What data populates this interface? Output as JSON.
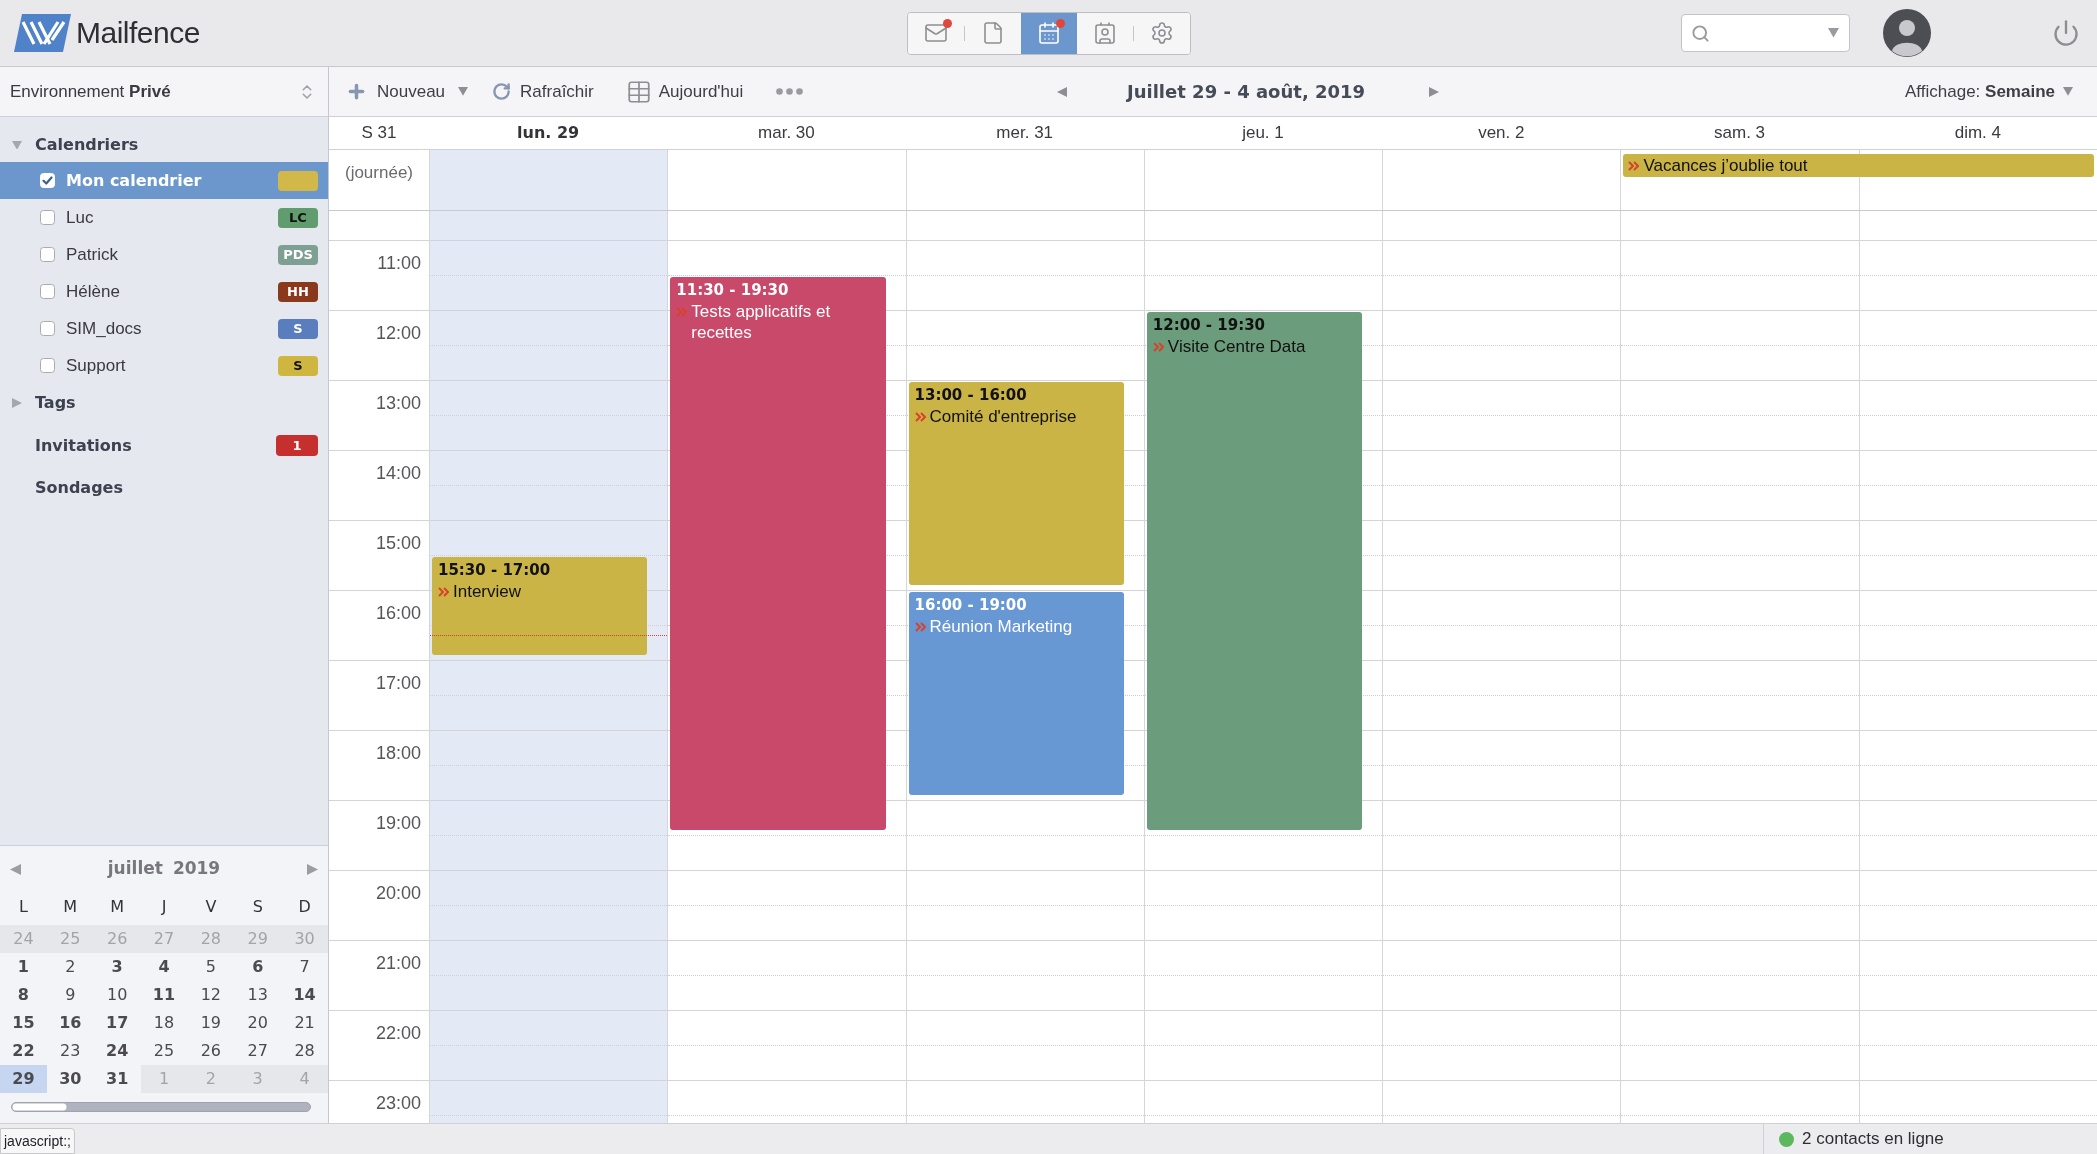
{
  "app": {
    "name": "Mailfence"
  },
  "app_switcher": [
    {
      "kind": "mail",
      "selected": false,
      "notification": true
    },
    {
      "kind": "documents",
      "selected": false,
      "notification": false
    },
    {
      "kind": "calendar",
      "selected": true,
      "notification": true
    },
    {
      "kind": "contacts",
      "selected": false,
      "notification": false
    },
    {
      "kind": "settings",
      "selected": false,
      "notification": false
    }
  ],
  "sidebar": {
    "environment": "Environnement **Privé**",
    "calendars": {
      "title": "Calendriers",
      "expanded": true,
      "items": [
        {
          "name": "Mon calendrier",
          "checked": true,
          "selected": true,
          "color": "#d2b848"
        },
        {
          "name": "Luc",
          "checked": false,
          "selected": false,
          "badge": "LC",
          "color": "#619c6e",
          "dark_text": true
        },
        {
          "name": "Patrick",
          "checked": false,
          "selected": false,
          "badge": "PDS",
          "color": "#7f9f92",
          "dark_text": false
        },
        {
          "name": "Hélène",
          "checked": false,
          "selected": false,
          "badge": "HH",
          "color": "#8a391d",
          "dark_text": false
        },
        {
          "name": "SIM_docs",
          "checked": false,
          "selected": false,
          "badge": "S",
          "color": "#5a7dbd",
          "dark_text": false
        },
        {
          "name": "Support",
          "checked": false,
          "selected": false,
          "badge": "S",
          "color": "#cfb641",
          "dark_text": true
        }
      ]
    },
    "tags": {
      "title": "Tags",
      "expanded": false
    },
    "invitations": {
      "title": "Invitations",
      "count": "1"
    },
    "polls": {
      "title": "Sondages"
    },
    "mini_calendar": {
      "month": "juillet",
      "year": "2019",
      "weekdays": [
        "L",
        "M",
        "M",
        "J",
        "V",
        "S",
        "D"
      ],
      "weeks": [
        {
          "days": [
            {
              "label": "24",
              "other_month": true,
              "has_events": false,
              "selected": false
            },
            {
              "label": "25",
              "other_month": true,
              "has_events": false,
              "selected": false
            },
            {
              "label": "26",
              "other_month": true,
              "has_events": false,
              "selected": false
            },
            {
              "label": "27",
              "other_month": true,
              "has_events": false,
              "selected": false
            },
            {
              "label": "28",
              "other_month": true,
              "has_events": false,
              "selected": false
            },
            {
              "label": "29",
              "other_month": true,
              "has_events": false,
              "selected": false
            },
            {
              "label": "30",
              "other_month": true,
              "has_events": false,
              "selected": false
            }
          ]
        },
        {
          "days": [
            {
              "label": "1",
              "other_month": false,
              "has_events": true,
              "selected": false
            },
            {
              "label": "2",
              "other_month": false,
              "has_events": false,
              "selected": false
            },
            {
              "label": "3",
              "other_month": false,
              "has_events": true,
              "selected": false
            },
            {
              "label": "4",
              "other_month": false,
              "has_events": true,
              "selected": false
            },
            {
              "label": "5",
              "other_month": false,
              "has_events": false,
              "selected": false
            },
            {
              "label": "6",
              "other_month": false,
              "has_events": true,
              "selected": false
            },
            {
              "label": "7",
              "other_month": false,
              "has_events": false,
              "selected": false
            }
          ]
        },
        {
          "days": [
            {
              "label": "8",
              "other_month": false,
              "has_events": true,
              "selected": false
            },
            {
              "label": "9",
              "other_month": false,
              "has_events": false,
              "selected": false
            },
            {
              "label": "10",
              "other_month": false,
              "has_events": false,
              "selected": false
            },
            {
              "label": "11",
              "other_month": false,
              "has_events": true,
              "selected": false
            },
            {
              "label": "12",
              "other_month": false,
              "has_events": false,
              "selected": false
            },
            {
              "label": "13",
              "other_month": false,
              "has_events": false,
              "selected": false
            },
            {
              "label": "14",
              "other_month": false,
              "has_events": true,
              "selected": false
            }
          ]
        },
        {
          "days": [
            {
              "label": "15",
              "other_month": false,
              "has_events": true,
              "selected": false
            },
            {
              "label": "16",
              "other_month": false,
              "has_events": true,
              "selected": false
            },
            {
              "label": "17",
              "other_month": false,
              "has_events": true,
              "selected": false
            },
            {
              "label": "18",
              "other_month": false,
              "has_events": false,
              "selected": false
            },
            {
              "label": "19",
              "other_month": false,
              "has_events": false,
              "selected": false
            },
            {
              "label": "20",
              "other_month": false,
              "has_events": false,
              "selected": false
            },
            {
              "label": "21",
              "other_month": false,
              "has_events": false,
              "selected": false
            }
          ]
        },
        {
          "days": [
            {
              "label": "22",
              "other_month": false,
              "has_events": true,
              "selected": false
            },
            {
              "label": "23",
              "other_month": false,
              "has_events": false,
              "selected": false
            },
            {
              "label": "24",
              "other_month": false,
              "has_events": true,
              "selected": false
            },
            {
              "label": "25",
              "other_month": false,
              "has_events": false,
              "selected": false
            },
            {
              "label": "26",
              "other_month": false,
              "has_events": false,
              "selected": false
            },
            {
              "label": "27",
              "other_month": false,
              "has_events": false,
              "selected": false
            },
            {
              "label": "28",
              "other_month": false,
              "has_events": false,
              "selected": false
            }
          ]
        },
        {
          "days": [
            {
              "label": "29",
              "other_month": false,
              "has_events": true,
              "selected": true
            },
            {
              "label": "30",
              "other_month": false,
              "has_events": true,
              "selected": false
            },
            {
              "label": "31",
              "other_month": false,
              "has_events": true,
              "selected": false
            },
            {
              "label": "1",
              "other_month": true,
              "has_events": false,
              "selected": false
            },
            {
              "label": "2",
              "other_month": true,
              "has_events": false,
              "selected": false
            },
            {
              "label": "3",
              "other_month": true,
              "has_events": false,
              "selected": false
            },
            {
              "label": "4",
              "other_month": true,
              "has_events": false,
              "selected": false
            }
          ]
        }
      ]
    }
  },
  "toolbar": {
    "actions": [
      {
        "kind": "new",
        "label": "Nouveau"
      },
      {
        "kind": "refresh",
        "label": "Rafraîchir"
      },
      {
        "kind": "today",
        "label": "Aujourd'hui"
      },
      {
        "kind": "more"
      }
    ],
    "range": "Juillet 29 - 4 août, 2019",
    "view": "Affichage: **Semaine**"
  },
  "calendar": {
    "week": "S 31",
    "all_day_label": "(journée)",
    "hours": [
      "11:00",
      "12:00",
      "13:00",
      "14:00",
      "15:00",
      "16:00",
      "17:00",
      "18:00",
      "19:00",
      "20:00",
      "21:00",
      "22:00",
      "23:00"
    ],
    "days": [
      {
        "label": "lun. 29",
        "today": true,
        "events": [
          {
            "time": "15:30 - 17:00",
            "title": "Interview",
            "color": "#cab445",
            "dark_text": true
          }
        ]
      },
      {
        "label": "mar. 30",
        "today": false,
        "events": [
          {
            "time": "11:30 - 19:30",
            "title": "Tests applicatifs et recettes",
            "color": "#c8496a",
            "dark_text": false
          }
        ]
      },
      {
        "label": "mer. 31",
        "today": false,
        "events": [
          {
            "time": "13:00 - 16:00",
            "title": "Comité d'entreprise",
            "color": "#cab445",
            "dark_text": true
          },
          {
            "time": "16:00 - 19:00",
            "title": "Réunion Marketing",
            "color": "#6898d3",
            "dark_text": false
          }
        ]
      },
      {
        "label": "jeu. 1",
        "today": false,
        "events": [
          {
            "time": "12:00 - 19:30",
            "title": "Visite Centre Data",
            "color": "#6b9c7b",
            "dark_text": true
          }
        ]
      },
      {
        "label": "ven. 2",
        "today": false
      },
      {
        "label": "sam. 3",
        "today": false,
        "all_day_event": {
          "title": "Vacances j’oublie tout",
          "color": "#cab445",
          "multi_day": true
        }
      },
      {
        "label": "dim. 4",
        "today": false
      }
    ]
  },
  "status_bar": {
    "link": "javascript:;",
    "online": "2 contacts en ligne"
  }
}
